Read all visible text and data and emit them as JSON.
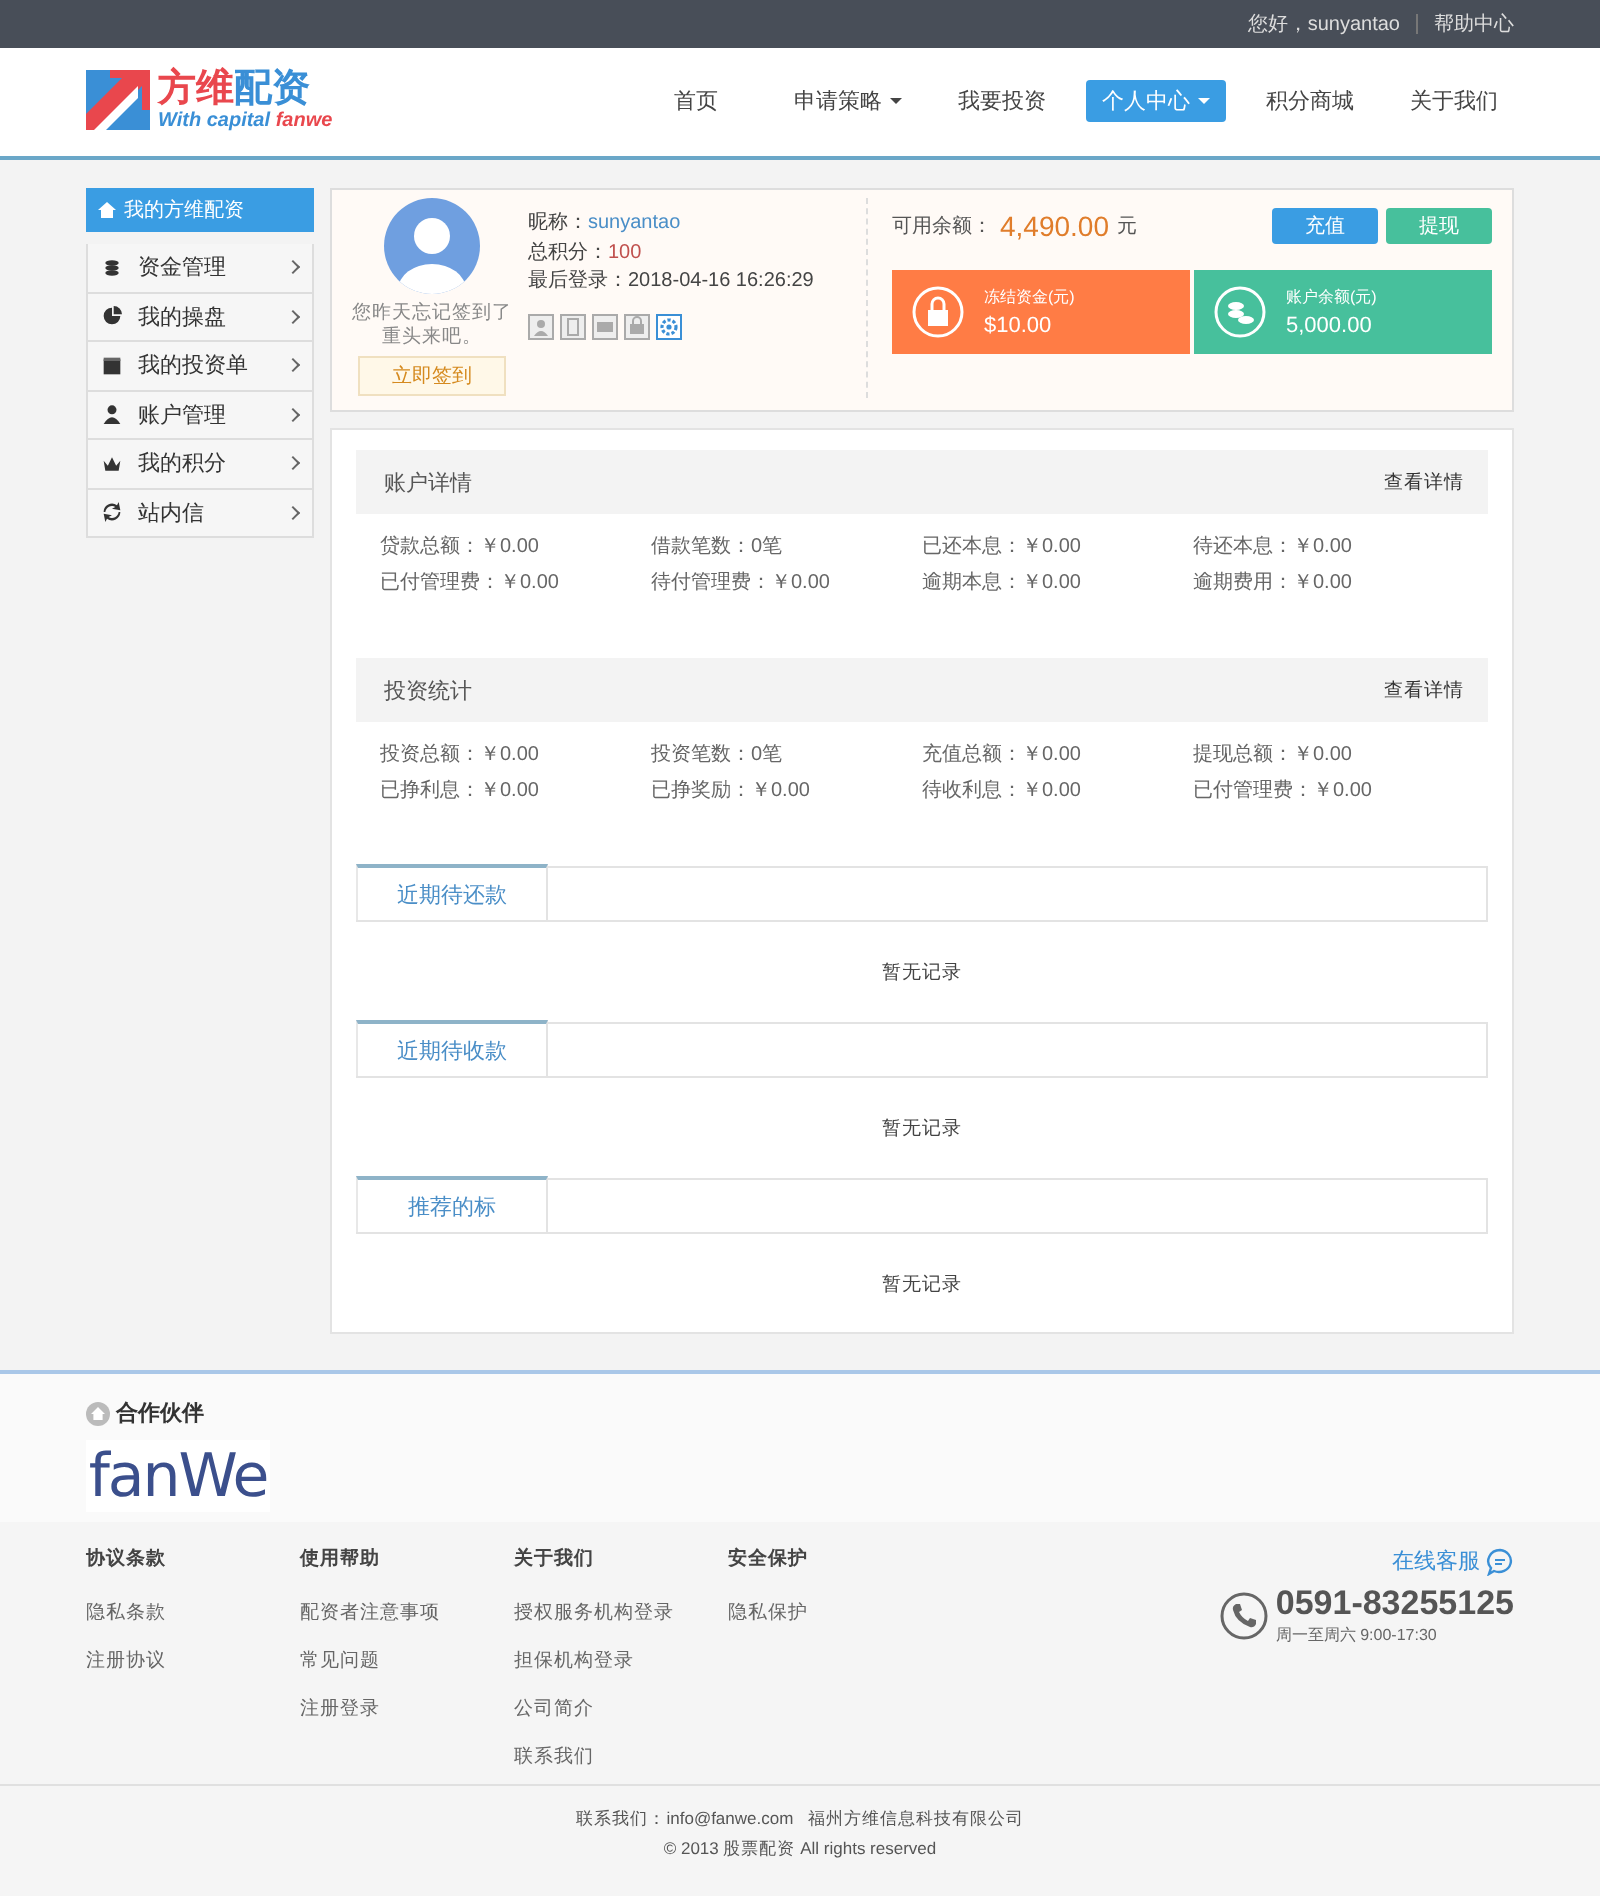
{
  "top_bar": {
    "greeting": "您好，sunyantao",
    "help_link": "帮助中心"
  },
  "logo": {
    "name_a": "方维",
    "name_b": "配资",
    "tagline_a": "With capital ",
    "tagline_b": "fanwe"
  },
  "nav": [
    {
      "label": "首页",
      "selected": false,
      "dropdown": false
    },
    {
      "label": "申请策略",
      "selected": false,
      "dropdown": true
    },
    {
      "label": "我要投资",
      "selected": false,
      "dropdown": false
    },
    {
      "label": "个人中心",
      "selected": true,
      "dropdown": true
    },
    {
      "label": "积分商城",
      "selected": false,
      "dropdown": false
    },
    {
      "label": "关于我们",
      "selected": false,
      "dropdown": false
    }
  ],
  "sidebar": {
    "title": "我的方维配资",
    "items": [
      {
        "label": "资金管理"
      },
      {
        "label": "我的操盘"
      },
      {
        "label": "我的投资单"
      },
      {
        "label": "账户管理"
      },
      {
        "label": "我的积分"
      },
      {
        "label": "站内信"
      }
    ]
  },
  "profile": {
    "nickname_label": "昵称：",
    "nickname": "sunyantao",
    "points_label": "总积分：",
    "points": "100",
    "last_login_label": "最后登录：",
    "last_login": "2018-04-16 16:26:29",
    "sign_hint": "您昨天忘记签到了重头来吧。",
    "sign_button": "立即签到",
    "verify_icons": [
      {
        "on": false
      },
      {
        "on": false
      },
      {
        "on": false
      },
      {
        "on": false
      },
      {
        "on": true
      }
    ],
    "balance_label": "可用余额：",
    "balance": "4,490.00",
    "balance_unit": "元",
    "buttons": [
      {
        "label": "充值",
        "color": "#3a9de3"
      },
      {
        "label": "提现",
        "color": "#47c09c"
      }
    ],
    "cards": [
      {
        "label": "冻结资金(元)",
        "value": "$10.00",
        "color": "#ff7c45"
      },
      {
        "label": "账户余额(元)",
        "value": "5,000.00",
        "color": "#47c09c"
      }
    ]
  },
  "sections": [
    {
      "title": "账户详情",
      "link": "查看详情",
      "items": [
        {
          "label": "贷款总额：",
          "value": "￥0.00"
        },
        {
          "label": "借款笔数：",
          "value": "0笔"
        },
        {
          "label": "已还本息：",
          "value": "￥0.00"
        },
        {
          "label": "待还本息：",
          "value": "￥0.00"
        },
        {
          "label": "已付管理费：",
          "value": "￥0.00"
        },
        {
          "label": "待付管理费：",
          "value": "￥0.00"
        },
        {
          "label": "逾期本息：",
          "value": "￥0.00"
        },
        {
          "label": "逾期费用：",
          "value": "￥0.00"
        }
      ]
    },
    {
      "title": "投资统计",
      "link": "查看详情",
      "items": [
        {
          "label": "投资总额：",
          "value": "￥0.00"
        },
        {
          "label": "投资笔数：",
          "value": "0笔"
        },
        {
          "label": "充值总额：",
          "value": "￥0.00"
        },
        {
          "label": "提现总额：",
          "value": "￥0.00"
        },
        {
          "label": "已挣利息：",
          "value": "￥0.00"
        },
        {
          "label": "已挣奖励：",
          "value": "￥0.00"
        },
        {
          "label": "待收利息：",
          "value": "￥0.00"
        },
        {
          "label": "已付管理费：",
          "value": "￥0.00"
        }
      ]
    }
  ],
  "tab_boxes": [
    {
      "tab": "近期待还款",
      "empty": "暂无记录"
    },
    {
      "tab": "近期待收款",
      "empty": "暂无记录"
    },
    {
      "tab": "推荐的标",
      "empty": "暂无记录"
    }
  ],
  "partners": {
    "title": "合作伙伴",
    "logo": "fanWe"
  },
  "footer_columns": [
    {
      "title": "协议条款",
      "links": [
        "隐私条款",
        "注册协议"
      ]
    },
    {
      "title": "使用帮助",
      "links": [
        "配资者注意事项",
        "常见问题",
        "注册登录"
      ]
    },
    {
      "title": "关于我们",
      "links": [
        "授权服务机构登录",
        "担保机构登录",
        "公司简介",
        "联系我们"
      ]
    },
    {
      "title": "安全保护",
      "links": [
        "隐私保护"
      ]
    }
  ],
  "support": {
    "online": "在线客服",
    "phone": "0591-83255125",
    "hours": "周一至周六 9:00-17:30"
  },
  "bottom": {
    "contact": "联系我们：info@fanwe.com",
    "company": "福州方维信息科技有限公司",
    "copyright": "© 2013 股票配资 All rights reserved"
  }
}
